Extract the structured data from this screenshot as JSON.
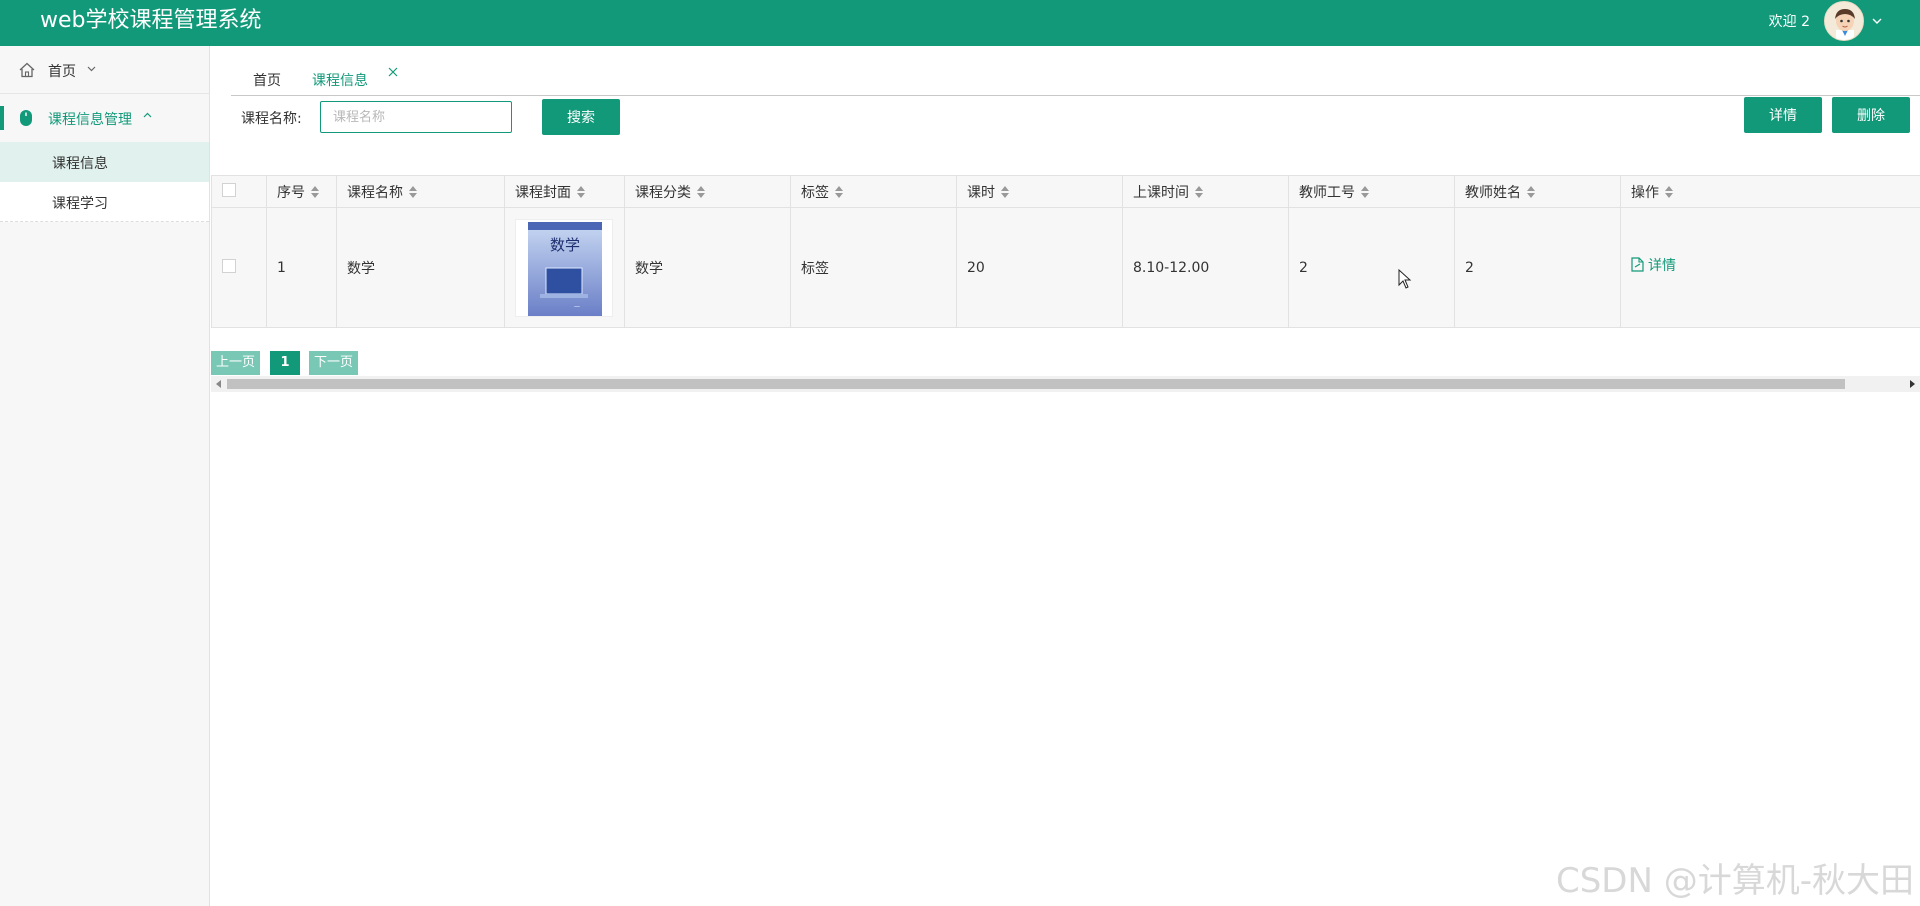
{
  "app": {
    "title": "web学校课程管理系统"
  },
  "header": {
    "welcome": "欢迎 2"
  },
  "sidebar": {
    "home_label": "首页",
    "group_label": "课程信息管理",
    "items": [
      {
        "label": "课程信息"
      },
      {
        "label": "课程学习"
      }
    ]
  },
  "tabs": [
    {
      "label": "首页"
    },
    {
      "label": "课程信息"
    }
  ],
  "search": {
    "label": "课程名称:",
    "placeholder": "课程名称",
    "value": "",
    "button_label": "搜索"
  },
  "toolbar": {
    "detail_label": "详情",
    "delete_label": "删除"
  },
  "table": {
    "columns": [
      "序号",
      "课程名称",
      "课程封面",
      "课程分类",
      "标签",
      "课时",
      "上课时间",
      "教师工号",
      "教师姓名",
      "操作"
    ],
    "rows": [
      {
        "index": "1",
        "name": "数学",
        "cover_title": "数学",
        "category": "数学",
        "tag": "标签",
        "hours": "20",
        "time": "8.10-12.00",
        "teacher_id": "2",
        "teacher_name": "2",
        "action_label": "详情"
      }
    ]
  },
  "pager": {
    "prev": "上一页",
    "current": "1",
    "next": "下一页"
  },
  "watermark": "CSDN @计算机-秋大田",
  "colors": {
    "primary": "#12997a",
    "pager_light": "#79c7b5"
  },
  "icons": {
    "home": "home-icon",
    "group": "mouse-icon",
    "detail": "document-icon",
    "close": "close-icon"
  }
}
